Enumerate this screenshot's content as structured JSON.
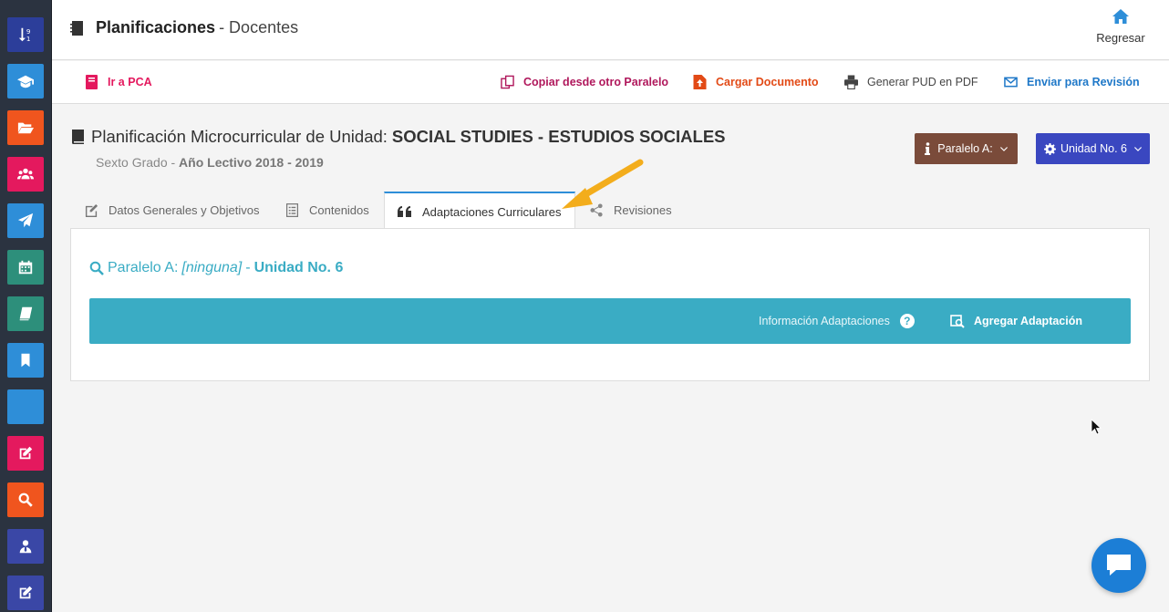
{
  "sidebar": {
    "items": [
      {
        "icon": "sort-numeric-icon",
        "color": "#2c3e9a"
      },
      {
        "icon": "graduation-cap-icon",
        "color": "#2e8ed8"
      },
      {
        "icon": "folder-open-icon",
        "color": "#f0551e"
      },
      {
        "icon": "users-icon",
        "color": "#e4195e"
      },
      {
        "icon": "paper-plane-icon",
        "color": "#2e8ed8"
      },
      {
        "icon": "calendar-icon",
        "color": "#2d8f7b"
      },
      {
        "icon": "book-icon",
        "color": "#2d8f7b"
      },
      {
        "icon": "bookmark-icon",
        "color": "#2e8ed8"
      },
      {
        "icon": "blank-icon",
        "color": "#2e8ed8"
      },
      {
        "icon": "edit-icon",
        "color": "#e4195e"
      },
      {
        "icon": "search-icon",
        "color": "#f0551e"
      },
      {
        "icon": "user-tie-icon",
        "color": "#3a47a6"
      },
      {
        "icon": "edit-icon",
        "color": "#3a47a6"
      }
    ]
  },
  "header": {
    "title": "Planificaciones",
    "subtitle": "- Docentes",
    "home_label": "Regresar"
  },
  "toolbar": {
    "pca_label": "Ir a PCA",
    "copy_label": "Copiar desde otro Paralelo",
    "upload_label": "Cargar Documento",
    "pdf_label": "Generar PUD en PDF",
    "review_label": "Enviar para Revisión",
    "colors": {
      "pca": "#e4195e",
      "copy": "#b0185c",
      "upload": "#e24a16",
      "pdf": "#444444",
      "review": "#1f78c8"
    }
  },
  "page": {
    "heading_prefix": "Planificación Microcurricular de Unidad:",
    "heading_subject": "SOCIAL STUDIES - ESTUDIOS SOCIALES",
    "grade": "Sexto Grado -",
    "year": "Año Lectivo 2018 - 2019",
    "paralelo_button": "Paralelo A:",
    "unidad_button": "Unidad No. 6"
  },
  "tabs": [
    {
      "label": "Datos Generales y Objetivos",
      "icon": "edit-icon"
    },
    {
      "label": "Contenidos",
      "icon": "list-icon"
    },
    {
      "label": "Adaptaciones Curriculares",
      "icon": "quote-icon",
      "active": true
    },
    {
      "label": "Revisiones",
      "icon": "share-icon"
    }
  ],
  "panel": {
    "search_prefix": "Paralelo A:",
    "search_value": "[ninguna]",
    "search_sep": "-",
    "search_unit": "Unidad No. 6",
    "info_label": "Información Adaptaciones",
    "info_icon": "?",
    "add_label": "Agregar Adaptación",
    "accent": "#3aacc4"
  }
}
